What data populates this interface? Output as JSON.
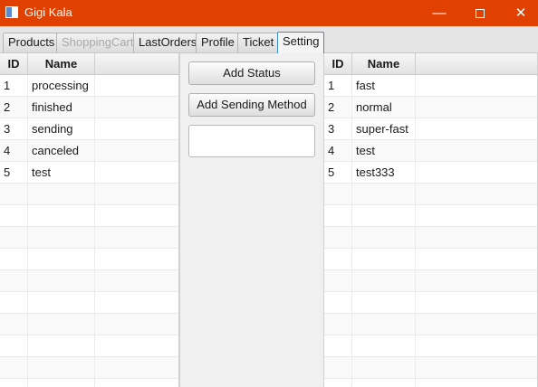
{
  "window": {
    "title": "Gigi Kala",
    "minimize_glyph": "—",
    "close_glyph": "✕"
  },
  "tabs": [
    {
      "label": "Products",
      "state": "normal"
    },
    {
      "label": "ShoppingCart",
      "state": "disabled"
    },
    {
      "label": "LastOrders",
      "state": "normal"
    },
    {
      "label": "Profile",
      "state": "normal"
    },
    {
      "label": "Ticket",
      "state": "normal"
    },
    {
      "label": "Setting",
      "state": "selected"
    }
  ],
  "status_table": {
    "columns": [
      "ID",
      "Name"
    ],
    "rows": [
      {
        "id": "1",
        "name": "processing"
      },
      {
        "id": "2",
        "name": "finished"
      },
      {
        "id": "3",
        "name": "sending"
      },
      {
        "id": "4",
        "name": "canceled"
      },
      {
        "id": "5",
        "name": "test"
      }
    ]
  },
  "actions": {
    "add_status_label": "Add Status",
    "add_sending_method_label": "Add Sending Method",
    "input_value": ""
  },
  "sending_table": {
    "columns": [
      "ID",
      "Name"
    ],
    "rows": [
      {
        "id": "1",
        "name": "fast"
      },
      {
        "id": "2",
        "name": "normal"
      },
      {
        "id": "3",
        "name": "super-fast"
      },
      {
        "id": "4",
        "name": "test"
      },
      {
        "id": "5",
        "name": "test333"
      }
    ]
  },
  "colors": {
    "titlebar": "#e04000",
    "selected_tab_border": "#3c8ad0"
  }
}
